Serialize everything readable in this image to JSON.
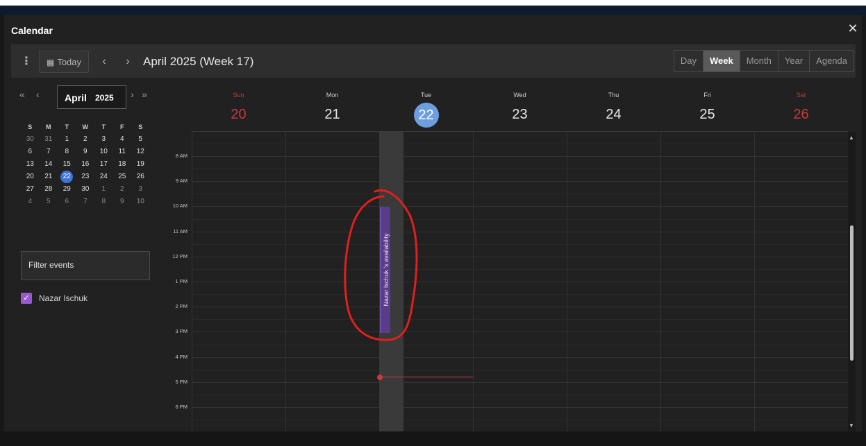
{
  "window": {
    "title": "Calendar",
    "close_icon": "close-icon"
  },
  "toolbar": {
    "more_icon": "more-vertical-icon",
    "today_label": "Today",
    "prev_icon": "chevron-left-icon",
    "next_icon": "chevron-right-icon",
    "range_title": "April 2025 (Week 17)",
    "views": [
      "Day",
      "Week",
      "Month",
      "Year",
      "Agenda"
    ],
    "active_view": "Week"
  },
  "mini_calendar": {
    "month": "April",
    "year": "2025",
    "weekday_headers": [
      "S",
      "M",
      "T",
      "W",
      "T",
      "F",
      "S"
    ],
    "weeks": [
      [
        "30",
        "31",
        "1",
        "2",
        "3",
        "4",
        "5"
      ],
      [
        "6",
        "7",
        "8",
        "9",
        "10",
        "11",
        "12"
      ],
      [
        "13",
        "14",
        "15",
        "16",
        "17",
        "18",
        "19"
      ],
      [
        "20",
        "21",
        "22",
        "23",
        "24",
        "25",
        "26"
      ],
      [
        "27",
        "28",
        "29",
        "30",
        "1",
        "2",
        "3"
      ],
      [
        "4",
        "5",
        "6",
        "7",
        "8",
        "9",
        "10"
      ]
    ],
    "today": "22"
  },
  "filter": {
    "label": "Filter events"
  },
  "calendars": [
    {
      "name": "Nazar Ischuk",
      "checked": true,
      "color": "#9b59d0"
    }
  ],
  "week": {
    "days": [
      {
        "name": "Sun",
        "date": "20",
        "weekend": true
      },
      {
        "name": "Mon",
        "date": "21"
      },
      {
        "name": "Tue",
        "date": "22",
        "today": true
      },
      {
        "name": "Wed",
        "date": "23"
      },
      {
        "name": "Thu",
        "date": "24"
      },
      {
        "name": "Fri",
        "date": "25"
      },
      {
        "name": "Sat",
        "date": "26",
        "weekend": true
      }
    ],
    "hours": [
      "8 AM",
      "9 AM",
      "10 AM",
      "11 AM",
      "12 PM",
      "1 PM",
      "2 PM",
      "3 PM",
      "4 PM",
      "5 PM",
      "6 PM"
    ]
  },
  "events": [
    {
      "title": "Nazar Ischuk 's availability",
      "day": "Tue",
      "color": "#5a3d8a"
    }
  ],
  "colors": {
    "accent": "#3e74d6",
    "today_circle": "#6d9ee0",
    "weekend": "#c9393d",
    "now_line": "#d0393b",
    "annotation": "#e0201c"
  }
}
